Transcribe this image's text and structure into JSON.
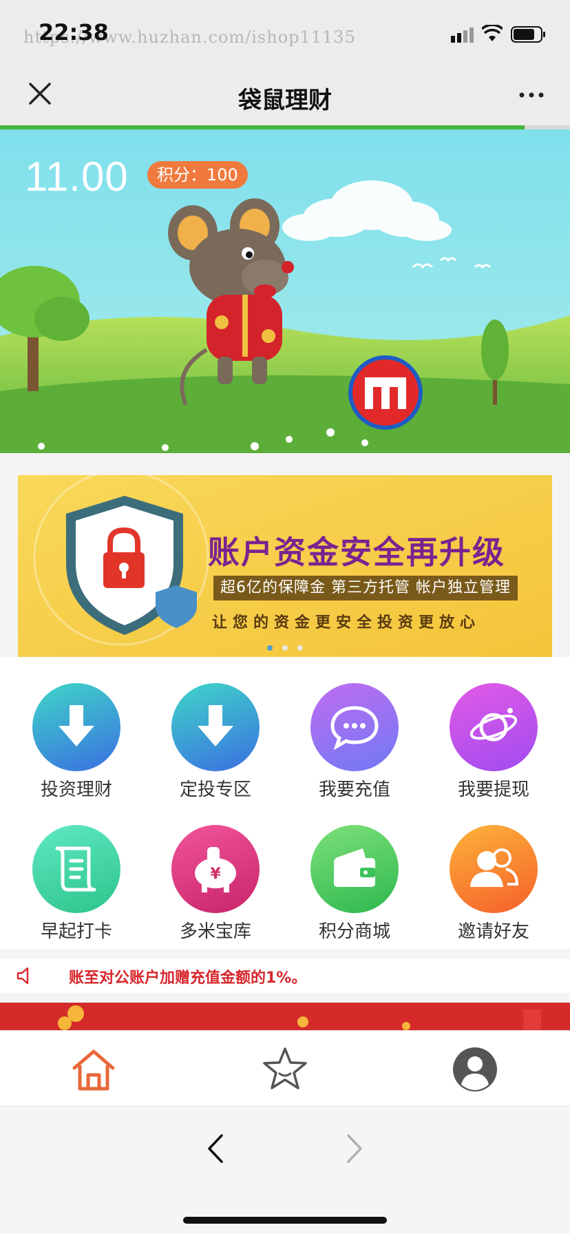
{
  "status_bar": {
    "time": "22:38",
    "watermark": "https://www.huzhan.com/ishop11135"
  },
  "nav": {
    "title": "袋鼠理财",
    "close_icon": "close-icon",
    "more_icon": "more-icon",
    "page_load_progress": 0.92
  },
  "hero": {
    "balance": "11.00",
    "points": "积分：100"
  },
  "security_banner": {
    "title": "账户资金安全再升级",
    "subtitle": "超6亿的保障金  第三方托管  帐户独立管理",
    "subtitle2": "让您的资金更安全投资更放心",
    "slide_count": 3,
    "active_slide": 1
  },
  "menu": {
    "items": [
      {
        "label": "投资理财",
        "icon": "download-arrow-icon",
        "color_from": "#3fd6c8",
        "color_to": "#3a6fe0"
      },
      {
        "label": "定投专区",
        "icon": "download-arrow-icon",
        "color_from": "#3fd6c8",
        "color_to": "#3a6fe0"
      },
      {
        "label": "我要充值",
        "icon": "chat-bubble-icon",
        "color_from": "#c06cf0",
        "color_to": "#6f7af5"
      },
      {
        "label": "我要提现",
        "icon": "planet-icon",
        "color_from": "#e25ae6",
        "color_to": "#a04cf0"
      },
      {
        "label": "早起打卡",
        "icon": "scroll-icon",
        "color_from": "#5fe8c4",
        "color_to": "#2ec48a"
      },
      {
        "label": "多米宝库",
        "icon": "piggy-bank-icon",
        "color_from": "#f2559a",
        "color_to": "#c8246a"
      },
      {
        "label": "积分商城",
        "icon": "wallet-icon",
        "color_from": "#7ee07a",
        "color_to": "#2db84e"
      },
      {
        "label": "邀请好友",
        "icon": "friends-icon",
        "color_from": "#fdb23a",
        "color_to": "#f5602a"
      }
    ]
  },
  "notice": {
    "icon": "speaker-icon",
    "text": "账至对公账户加赠充值金额的1%。"
  },
  "tab_bar": {
    "home_icon": "home-icon",
    "favorite_icon": "star-icon",
    "profile_icon": "user-avatar-icon",
    "active_color": "#e8683a"
  },
  "browser": {
    "back_icon": "chevron-left-icon",
    "forward_icon": "chevron-right-icon"
  }
}
